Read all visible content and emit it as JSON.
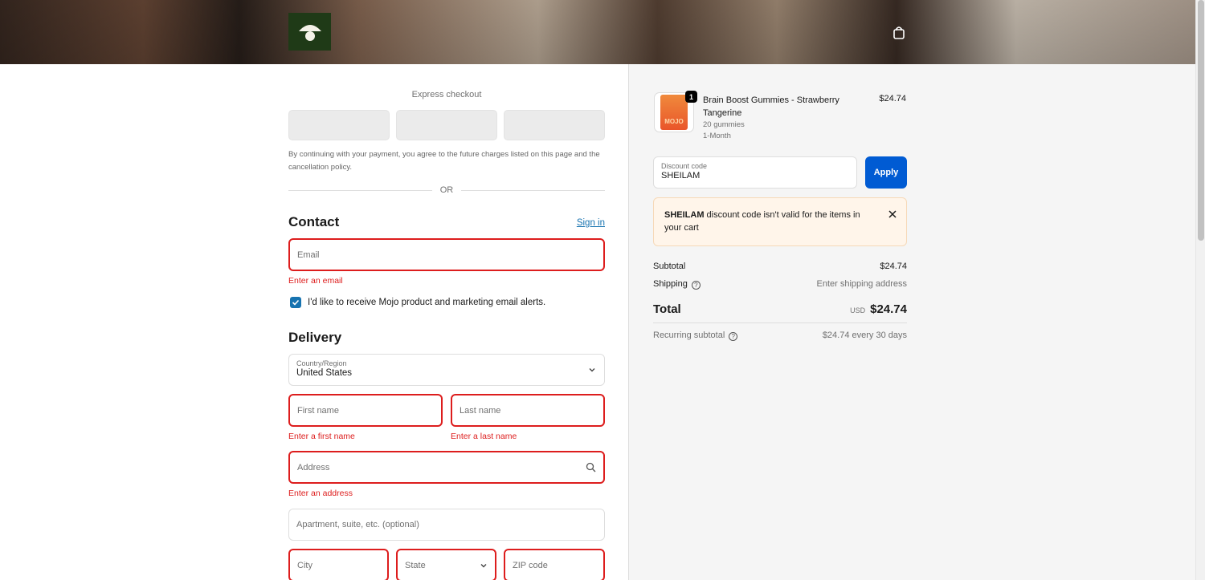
{
  "header": {
    "logo_name": "mushroom-logo",
    "cart_icon": "shopping-bag-icon"
  },
  "express": {
    "title": "Express checkout",
    "consent": "By continuing with your payment, you agree to the future charges listed on this page and the cancellation policy.",
    "or": "OR"
  },
  "contact": {
    "title": "Contact",
    "signin": "Sign in",
    "email_placeholder": "Email",
    "email_error": "Enter an email",
    "marketing_label": "I'd like to receive Mojo product and marketing email alerts.",
    "marketing_checked": true
  },
  "delivery": {
    "title": "Delivery",
    "country_label": "Country/Region",
    "country_value": "United States",
    "first_name_placeholder": "First name",
    "first_name_error": "Enter a first name",
    "last_name_placeholder": "Last name",
    "last_name_error": "Enter a last name",
    "address_placeholder": "Address",
    "address_error": "Enter an address",
    "apartment_placeholder": "Apartment, suite, etc. (optional)",
    "city_placeholder": "City",
    "state_placeholder": "State",
    "zip_placeholder": "ZIP code"
  },
  "summary": {
    "product": {
      "name": "Brain Boost Gummies - Strawberry Tangerine",
      "variant": "20 gummies",
      "plan": "1-Month",
      "price": "$24.74",
      "quantity": "1",
      "package_text": "MOJO"
    },
    "discount_label": "Discount code",
    "discount_value": "SHEILAM",
    "apply_label": "Apply",
    "notice_code": "SHEILAM",
    "notice_text": " discount code isn't valid for the items in your cart",
    "subtotal_label": "Subtotal",
    "subtotal_value": "$24.74",
    "shipping_label": "Shipping",
    "shipping_value": "Enter shipping address",
    "total_label": "Total",
    "total_currency": "USD",
    "total_value": "$24.74",
    "recurring_label": "Recurring subtotal",
    "recurring_value": "$24.74 every 30 days"
  },
  "colors": {
    "primary": "#005bd3",
    "error": "#dd1d1d",
    "link": "#1773b0",
    "logo_bg": "#1f3a17"
  }
}
